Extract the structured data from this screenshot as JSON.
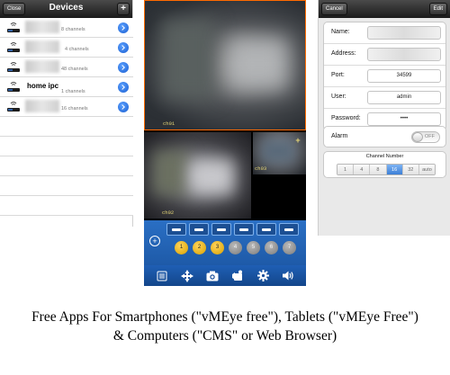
{
  "devices_screen": {
    "title": "Devices",
    "close_label": "Close",
    "add_label": "+",
    "rows": [
      {
        "name": "",
        "channels": "8 channels"
      },
      {
        "name": "",
        "channels": "4 channels"
      },
      {
        "name": "",
        "channels": "48 channels"
      },
      {
        "name": "home ipc",
        "channels": "1 channels"
      },
      {
        "name": "",
        "channels": "16 channels"
      }
    ]
  },
  "live_screen": {
    "cameras": [
      {
        "label": "ch01"
      },
      {
        "label": "ch02"
      },
      {
        "label": "ch03"
      }
    ],
    "add_label": "+",
    "channel_buttons": [
      {
        "label": "1",
        "state": "on"
      },
      {
        "label": "2",
        "state": "on"
      },
      {
        "label": "3",
        "state": "on"
      },
      {
        "label": "4",
        "state": "off"
      },
      {
        "label": "5",
        "state": "off"
      },
      {
        "label": "6",
        "state": "off"
      },
      {
        "label": "7",
        "state": "off"
      }
    ],
    "toolbar_icons": [
      "list-icon",
      "ptz-move-icon",
      "camera-icon",
      "record-icon",
      "settings-icon",
      "speaker-icon"
    ],
    "accent_color": "#1e5aa8"
  },
  "edit_screen": {
    "cancel_label": "Cancel",
    "edit_label": "Edit",
    "fields": [
      {
        "label": "Name:",
        "value": ""
      },
      {
        "label": "Address:",
        "value": ""
      },
      {
        "label": "Port:",
        "value": "34599"
      },
      {
        "label": "User:",
        "value": "admin"
      },
      {
        "label": "Password:",
        "value": "••••"
      }
    ],
    "alarm_label": "Alarm",
    "alarm_state": "OFF",
    "channel_number_title": "Channel Number",
    "channel_options": [
      "1",
      "4",
      "8",
      "16",
      "32",
      "auto"
    ],
    "selected_channel": "16"
  },
  "caption": {
    "line1": "Free Apps For Smartphones (\"vMEye free\"), Tablets (\"vMEye Free\")",
    "line2": "& Computers (\"CMS\" or Web Browser)"
  }
}
